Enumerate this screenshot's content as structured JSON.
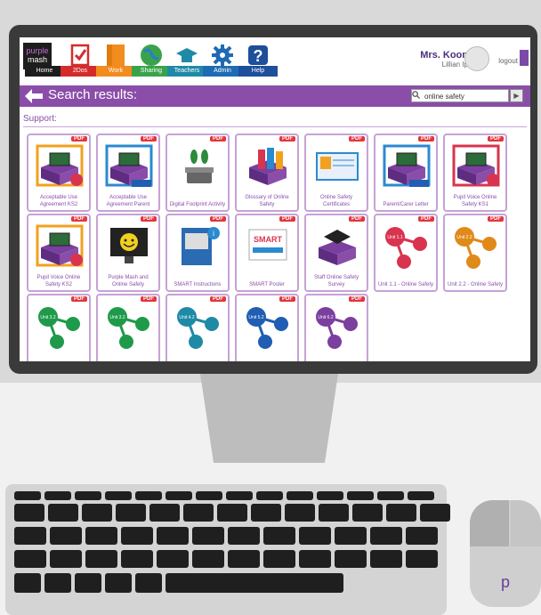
{
  "app": {
    "logo": {
      "line1": "purple",
      "line2": "mash"
    },
    "nav": [
      {
        "label": "Home",
        "color": "#1d1d1d",
        "icon": "home-icon"
      },
      {
        "label": "2Dos",
        "color": "#d42c2c",
        "icon": "checklist-icon"
      },
      {
        "label": "Work",
        "color": "#f28c1e",
        "icon": "folder-icon"
      },
      {
        "label": "Sharing",
        "color": "#3aa34a",
        "icon": "globe-icon"
      },
      {
        "label": "Teachers",
        "color": "#1f8aa6",
        "icon": "graduation-cap-icon"
      },
      {
        "label": "Admin",
        "color": "#1f6bb3",
        "icon": "gear-icon"
      },
      {
        "label": "Help",
        "color": "#1d4f9a",
        "icon": "help-icon"
      }
    ],
    "user": {
      "name": "Mrs. Koon",
      "subtitle": "Lillian Ip",
      "logout": "logout"
    },
    "search_bar": {
      "title": "Search results:",
      "query": "online safety"
    },
    "section": "Support:",
    "tiles": [
      {
        "caption": "Acceptable Use Agreement KS2",
        "badge": "PDF",
        "thumb": "laptop-box-orange",
        "tag": "KS2"
      },
      {
        "caption": "Acceptable Use Agreement Parent",
        "badge": "PDF",
        "thumb": "laptop-box-blue",
        "tag": "Parent"
      },
      {
        "caption": "Digital Footprint Activity",
        "badge": "PDF",
        "thumb": "footprint-scale",
        "tag": ""
      },
      {
        "caption": "Glossary of Online Safety",
        "badge": "PDF",
        "thumb": "books-box",
        "tag": ""
      },
      {
        "caption": "Online Safety Certificates",
        "badge": "PDF",
        "thumb": "certificate",
        "tag": ""
      },
      {
        "caption": "Parent/Carer Letter",
        "badge": "PDF",
        "thumb": "laptop-box-blue",
        "tag": "Parent"
      },
      {
        "caption": "Pupil Voice Online Safety KS1",
        "badge": "PDF",
        "thumb": "laptop-box-red",
        "tag": "KS1"
      },
      {
        "caption": "Pupil Voice Online Safety KS2",
        "badge": "PDF",
        "thumb": "laptop-box-orange",
        "tag": "KS2"
      },
      {
        "caption": "Purple Mash and Online Safety",
        "badge": "PDF",
        "thumb": "smiley-screen",
        "tag": ""
      },
      {
        "caption": "SMART Instructions",
        "badge": "PDF",
        "thumb": "book-info",
        "tag": ""
      },
      {
        "caption": "SMART Poster",
        "badge": "PDF",
        "thumb": "smart-poster",
        "tag": ""
      },
      {
        "caption": "Staff Online Safety Survey",
        "badge": "PDF",
        "thumb": "grad-box",
        "tag": ""
      },
      {
        "caption": "Unit 1.1 - Online Safety",
        "badge": "PDF",
        "thumb": "unit",
        "tag": "Unit 1.1",
        "color": "#d8344f"
      },
      {
        "caption": "Unit 2.2 - Online Safety",
        "badge": "PDF",
        "thumb": "unit",
        "tag": "Unit 2.2",
        "color": "#e08a1a"
      },
      {
        "caption": "",
        "badge": "PDF",
        "thumb": "unit",
        "tag": "Unit 3.2",
        "color": "#1f9a4a"
      },
      {
        "caption": "",
        "badge": "PDF",
        "thumb": "unit",
        "tag": "Unit 3.2",
        "color": "#1f9a4a"
      },
      {
        "caption": "",
        "badge": "PDF",
        "thumb": "unit",
        "tag": "Unit 4.2",
        "color": "#1f8aa6"
      },
      {
        "caption": "",
        "badge": "PDF",
        "thumb": "unit",
        "tag": "Unit 5.2",
        "color": "#1f5eb3"
      },
      {
        "caption": "",
        "badge": "PDF",
        "thumb": "unit",
        "tag": "Unit 6.2",
        "color": "#7b3fa0"
      }
    ]
  },
  "mouse_label": "p"
}
